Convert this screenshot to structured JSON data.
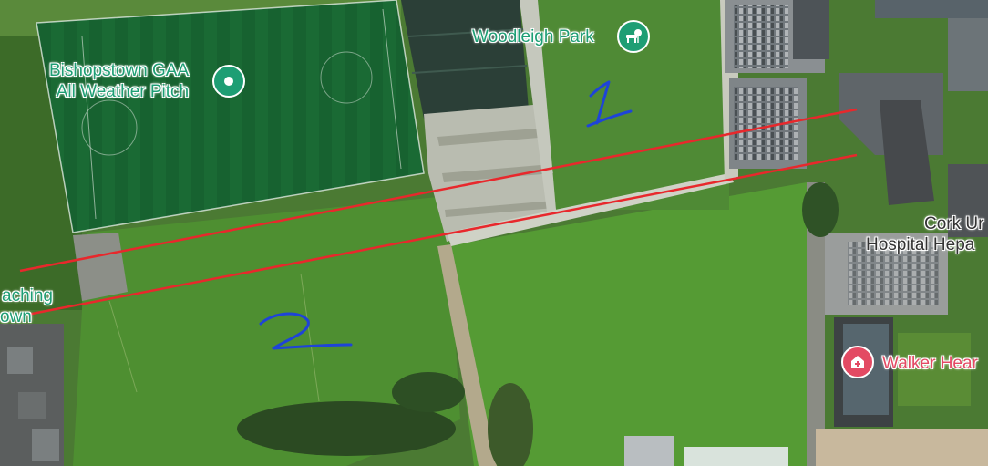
{
  "colors": {
    "sport_green": "#1e9e74",
    "hospital_red": "#e34a63",
    "route_red": "#e8282c",
    "ink_blue": "#1e44d8"
  },
  "places": {
    "gaa_pitch": {
      "line1": "Bishopstown GAA",
      "line2": "All Weather Pitch",
      "icon": "place-pin-icon"
    },
    "woodleigh": {
      "label": "Woodleigh Park",
      "icon": "park-icon"
    },
    "cork_hospital": {
      "line1": "Cork Ur",
      "line2": "Hospital Hepa"
    },
    "walker": {
      "label": "Walker Hear",
      "icon": "hospital-icon"
    },
    "left_place": {
      "line1": "aching",
      "line2": "own"
    }
  },
  "annotations": {
    "mark_1": "1",
    "mark_2": "2"
  }
}
